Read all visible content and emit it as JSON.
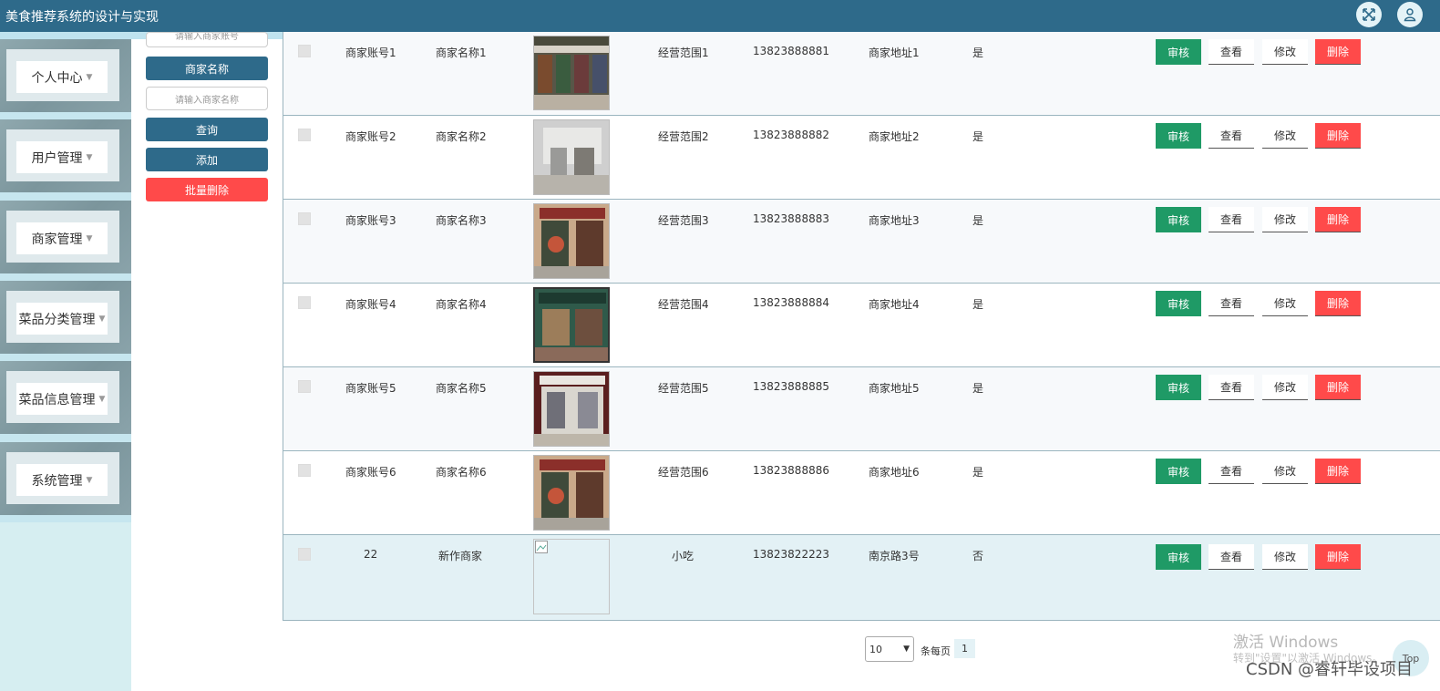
{
  "app": {
    "title": "美食推荐系统的设计与实现"
  },
  "header": {
    "fullscreen_icon": "expand-icon",
    "user_icon": "user-icon"
  },
  "sidebar": {
    "items": [
      {
        "label": "个人中心"
      },
      {
        "label": "用户管理"
      },
      {
        "label": "商家管理"
      },
      {
        "label": "菜品分类管理"
      },
      {
        "label": "菜品信息管理"
      },
      {
        "label": "系统管理"
      }
    ]
  },
  "search": {
    "account_placeholder": "请输入商家账号",
    "name_label": "商家名称",
    "name_placeholder": "请输入商家名称",
    "query_label": "查询",
    "add_label": "添加",
    "batch_delete_label": "批量删除"
  },
  "table": {
    "actions": {
      "audit": "审核",
      "view": "查看",
      "edit": "修改",
      "delete": "删除"
    },
    "rows": [
      {
        "account": "商家账号1",
        "name": "商家名称1",
        "scope": "经营范围1",
        "phone": "13823888881",
        "address": "商家地址1",
        "approved": "是"
      },
      {
        "account": "商家账号2",
        "name": "商家名称2",
        "scope": "经营范围2",
        "phone": "13823888882",
        "address": "商家地址2",
        "approved": "是"
      },
      {
        "account": "商家账号3",
        "name": "商家名称3",
        "scope": "经营范围3",
        "phone": "13823888883",
        "address": "商家地址3",
        "approved": "是"
      },
      {
        "account": "商家账号4",
        "name": "商家名称4",
        "scope": "经营范围4",
        "phone": "13823888884",
        "address": "商家地址4",
        "approved": "是"
      },
      {
        "account": "商家账号5",
        "name": "商家名称5",
        "scope": "经营范围5",
        "phone": "13823888885",
        "address": "商家地址5",
        "approved": "是"
      },
      {
        "account": "商家账号6",
        "name": "商家名称6",
        "scope": "经营范围6",
        "phone": "13823888886",
        "address": "商家地址6",
        "approved": "是"
      },
      {
        "account": "22",
        "name": "新作商家",
        "scope": "小吃",
        "phone": "13823822223",
        "address": "南京路3号",
        "approved": "否"
      }
    ]
  },
  "pagination": {
    "page_size": "10",
    "per_page_label": "条每页",
    "current_page": "1"
  },
  "watermark": {
    "line1": "激活 Windows",
    "line2": "转到\"设置\"以激活 Windows。",
    "csdn": "CSDN @睿轩毕设项目"
  },
  "back_to_top": "Top"
}
